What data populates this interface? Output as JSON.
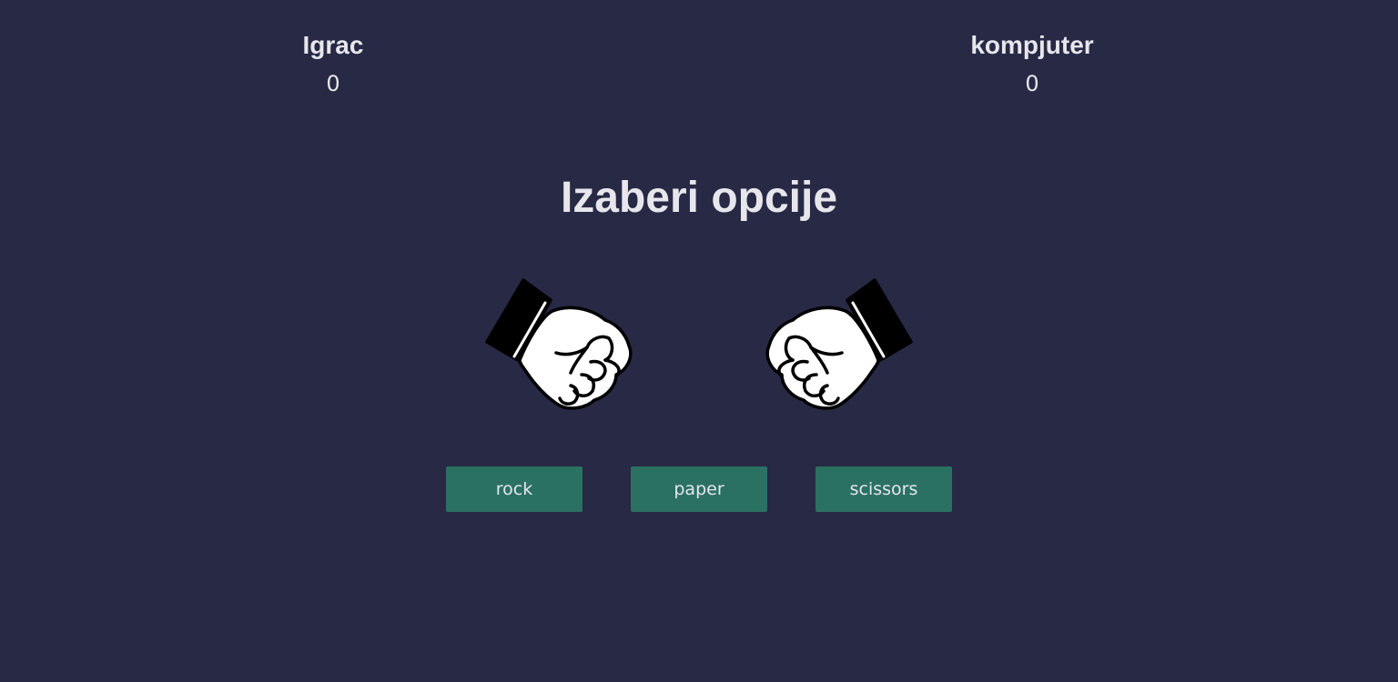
{
  "scoreboard": {
    "player": {
      "label": "Igrac",
      "score": "0"
    },
    "computer": {
      "label": "kompjuter",
      "score": "0"
    }
  },
  "prompt": "Izaberi opcije",
  "hands": {
    "player": {
      "icon": "fist-icon",
      "shape": "rock"
    },
    "computer": {
      "icon": "fist-icon",
      "shape": "rock"
    }
  },
  "choices": {
    "rock": "rock",
    "paper": "paper",
    "scissors": "scissors"
  },
  "colors": {
    "background": "#272945",
    "text": "#e6e6ec",
    "button": "#2b7161"
  }
}
